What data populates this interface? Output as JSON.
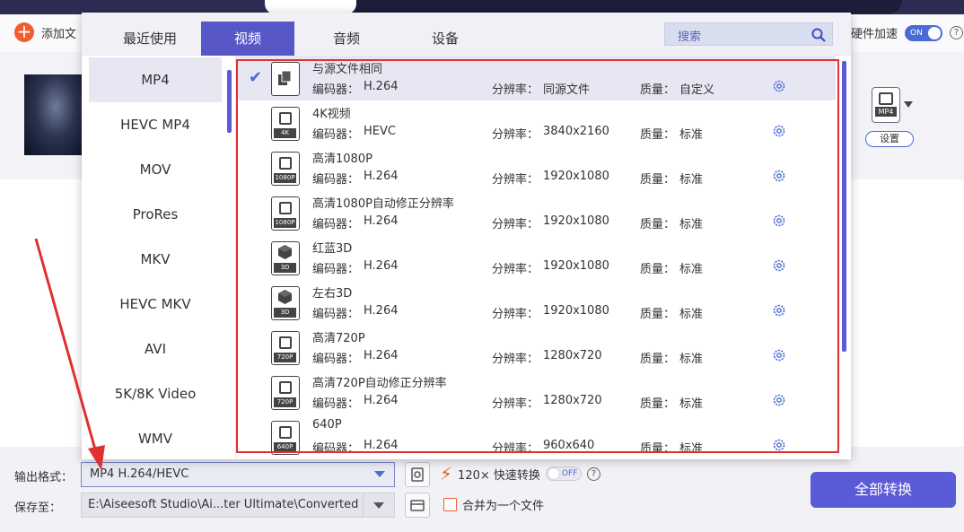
{
  "toolbar": {
    "add_files": "添加文",
    "hw_accel": "硬件加速",
    "hw_toggle": "ON",
    "help": "?"
  },
  "output_preview": {
    "format_label": "MP4",
    "settings_button": "设置"
  },
  "popup": {
    "tabs": [
      "最近使用",
      "视频",
      "音频",
      "设备"
    ],
    "search_placeholder": "搜索",
    "formats": [
      "MP4",
      "HEVC MP4",
      "MOV",
      "ProRes",
      "MKV",
      "HEVC MKV",
      "AVI",
      "5K/8K Video",
      "WMV"
    ],
    "encoder_label": "编码器：",
    "resolution_label": "分辨率：",
    "quality_label": "质量：",
    "profiles": [
      {
        "name": "与源文件相同",
        "encoder": "H.264",
        "resolution": "同源文件",
        "quality": "自定义",
        "tag": "",
        "icon": "stack-icon"
      },
      {
        "name": "4K视频",
        "encoder": "HEVC",
        "resolution": "3840x2160",
        "quality": "标准",
        "tag": "4K",
        "icon": "film-icon"
      },
      {
        "name": "高清1080P",
        "encoder": "H.264",
        "resolution": "1920x1080",
        "quality": "标准",
        "tag": "1080P",
        "icon": "film-icon"
      },
      {
        "name": "高清1080P自动修正分辨率",
        "encoder": "H.264",
        "resolution": "1920x1080",
        "quality": "标准",
        "tag": "1080P",
        "icon": "film-icon"
      },
      {
        "name": "红蓝3D",
        "encoder": "H.264",
        "resolution": "1920x1080",
        "quality": "标准",
        "tag": "3D",
        "icon": "cube-icon"
      },
      {
        "name": "左右3D",
        "encoder": "H.264",
        "resolution": "1920x1080",
        "quality": "标准",
        "tag": "3D",
        "icon": "cube-icon"
      },
      {
        "name": "高清720P",
        "encoder": "H.264",
        "resolution": "1280x720",
        "quality": "标准",
        "tag": "720P",
        "icon": "film-icon"
      },
      {
        "name": "高清720P自动修正分辨率",
        "encoder": "H.264",
        "resolution": "1280x720",
        "quality": "标准",
        "tag": "720P",
        "icon": "film-icon"
      },
      {
        "name": "640P",
        "encoder": "H.264",
        "resolution": "960x640",
        "quality": "标准",
        "tag": "640P",
        "icon": "film-icon"
      }
    ]
  },
  "bottom": {
    "output_format_label": "输出格式：",
    "output_format_value": "MP4 H.264/HEVC",
    "save_to_label": "保存至：",
    "save_to_value": "E:\\Aiseesoft Studio\\Ai...ter Ultimate\\Converted",
    "speed_text": "120× 快速转换",
    "speed_toggle": "OFF",
    "help": "?",
    "merge_label": "合并为一个文件",
    "convert_all": "全部转换"
  },
  "colors": {
    "accent": "#5757c8",
    "orange": "#ef5e30",
    "annotation_red": "#e03030"
  }
}
